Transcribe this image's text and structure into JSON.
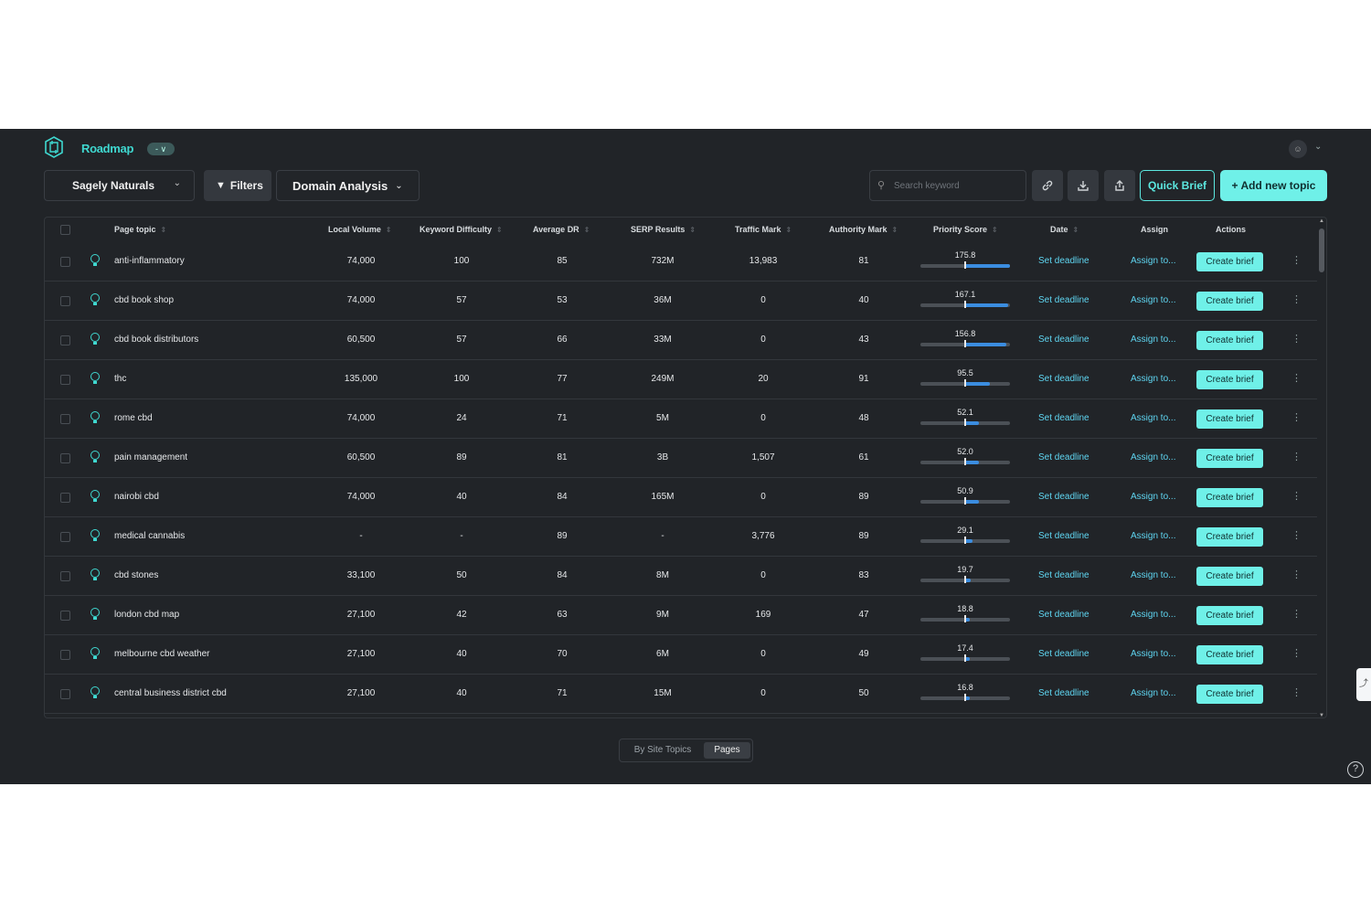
{
  "header": {
    "title": "Roadmap",
    "pill": "- ∨"
  },
  "toolbar": {
    "project": "Sagely Naturals",
    "filters_label": "Filters",
    "domain_analysis_label": "Domain Analysis",
    "search_placeholder": "Search keyword",
    "quick_brief_label": "Quick Brief",
    "add_topic_label": "+ Add new topic"
  },
  "table": {
    "columns": {
      "page_topic": "Page topic",
      "local_volume": "Local Volume",
      "keyword_difficulty": "Keyword Difficulty",
      "average_dr": "Average DR",
      "serp_results": "SERP Results",
      "traffic_mark": "Traffic Mark",
      "authority_mark": "Authority Mark",
      "priority_score": "Priority Score",
      "date": "Date",
      "assign": "Assign",
      "actions": "Actions"
    },
    "deadline_label": "Set deadline",
    "assign_label": "Assign to...",
    "create_brief_label": "Create brief",
    "rows": [
      {
        "topic": "anti-inflammatory",
        "volume": "74,000",
        "kd": "100",
        "dr": "85",
        "serp": "732M",
        "traffic": "13,983",
        "authority": "81",
        "priority": "175.8",
        "priority_fill": 1.0
      },
      {
        "topic": "cbd book shop",
        "volume": "74,000",
        "kd": "57",
        "dr": "53",
        "serp": "36M",
        "traffic": "0",
        "authority": "40",
        "priority": "167.1",
        "priority_fill": 0.96
      },
      {
        "topic": "cbd book distributors",
        "volume": "60,500",
        "kd": "57",
        "dr": "66",
        "serp": "33M",
        "traffic": "0",
        "authority": "43",
        "priority": "156.8",
        "priority_fill": 0.92
      },
      {
        "topic": "thc",
        "volume": "135,000",
        "kd": "100",
        "dr": "77",
        "serp": "249M",
        "traffic": "20",
        "authority": "91",
        "priority": "95.5",
        "priority_fill": 0.56
      },
      {
        "topic": "rome cbd",
        "volume": "74,000",
        "kd": "24",
        "dr": "71",
        "serp": "5M",
        "traffic": "0",
        "authority": "48",
        "priority": "52.1",
        "priority_fill": 0.31
      },
      {
        "topic": "pain management",
        "volume": "60,500",
        "kd": "89",
        "dr": "81",
        "serp": "3B",
        "traffic": "1,507",
        "authority": "61",
        "priority": "52.0",
        "priority_fill": 0.31
      },
      {
        "topic": "nairobi cbd",
        "volume": "74,000",
        "kd": "40",
        "dr": "84",
        "serp": "165M",
        "traffic": "0",
        "authority": "89",
        "priority": "50.9",
        "priority_fill": 0.3
      },
      {
        "topic": "medical cannabis",
        "volume": "-",
        "kd": "-",
        "dr": "89",
        "serp": "-",
        "traffic": "3,776",
        "authority": "89",
        "priority": "29.1",
        "priority_fill": 0.17
      },
      {
        "topic": "cbd stones",
        "volume": "33,100",
        "kd": "50",
        "dr": "84",
        "serp": "8M",
        "traffic": "0",
        "authority": "83",
        "priority": "19.7",
        "priority_fill": 0.12
      },
      {
        "topic": "london cbd map",
        "volume": "27,100",
        "kd": "42",
        "dr": "63",
        "serp": "9M",
        "traffic": "169",
        "authority": "47",
        "priority": "18.8",
        "priority_fill": 0.11
      },
      {
        "topic": "melbourne cbd weather",
        "volume": "27,100",
        "kd": "40",
        "dr": "70",
        "serp": "6M",
        "traffic": "0",
        "authority": "49",
        "priority": "17.4",
        "priority_fill": 0.1
      },
      {
        "topic": "central business district cbd",
        "volume": "27,100",
        "kd": "40",
        "dr": "71",
        "serp": "15M",
        "traffic": "0",
        "authority": "50",
        "priority": "16.8",
        "priority_fill": 0.1
      }
    ]
  },
  "view_toggle": {
    "by_site_topics": "By Site Topics",
    "pages": "Pages",
    "active": "pages"
  },
  "colors": {
    "background": "#212428",
    "accent": "#6ff0e8",
    "link": "#5fd6f2",
    "priority_bar": "#3b8de0"
  },
  "icons": [
    "logo-icon",
    "funnel-icon",
    "search-icon",
    "link-icon",
    "download-icon",
    "share-icon",
    "bulb-icon",
    "kebab-icon",
    "help-icon",
    "user-icon"
  ]
}
